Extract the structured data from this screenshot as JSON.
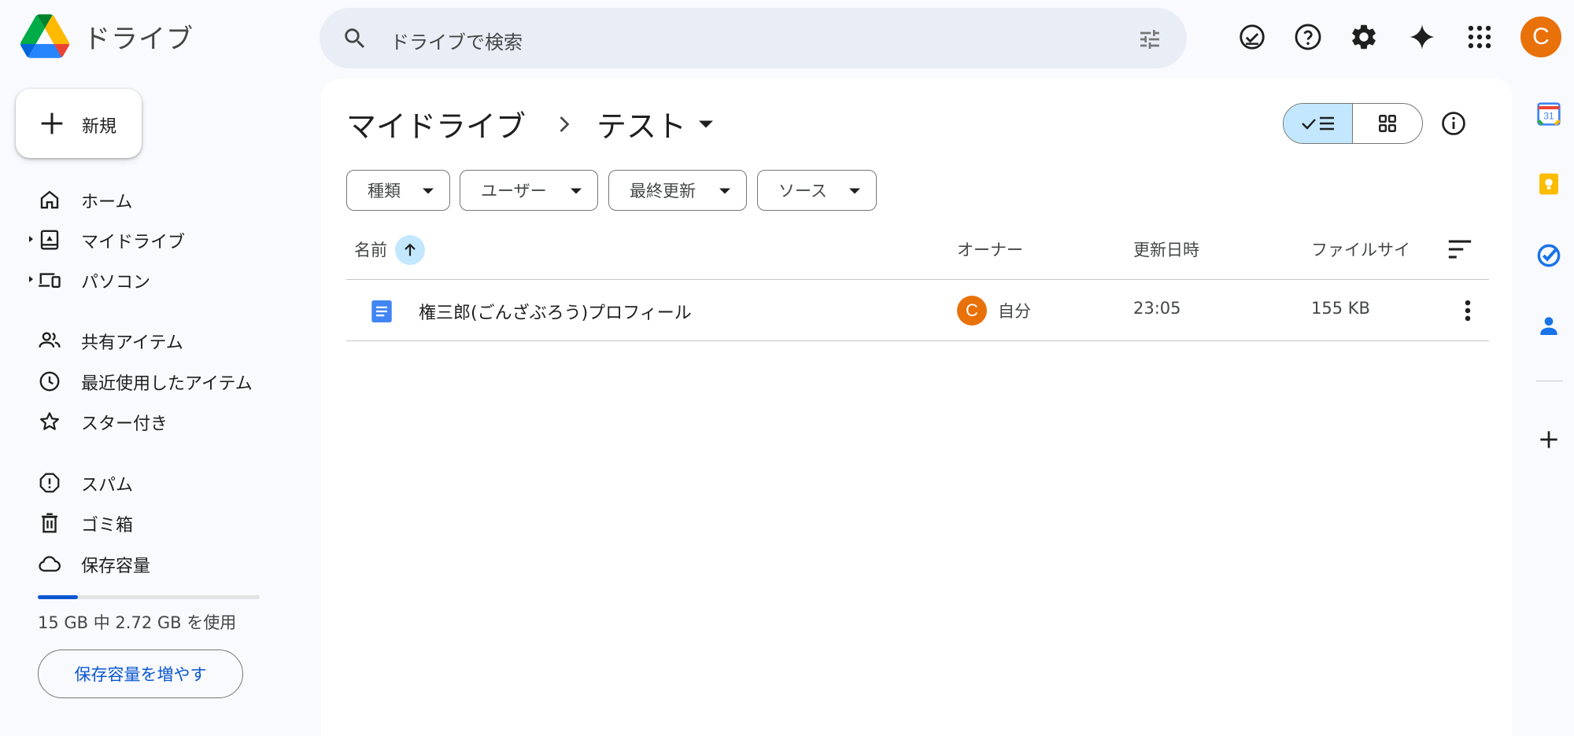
{
  "app": {
    "title": "ドライブ"
  },
  "search": {
    "placeholder": "ドライブで検索"
  },
  "header_icons": [
    "offline-ready-icon",
    "help-icon",
    "settings-icon",
    "gemini-icon",
    "apps-grid-icon"
  ],
  "account": {
    "initial": "C",
    "color": "#e8710a"
  },
  "new_button": {
    "label": "新規"
  },
  "nav": {
    "items": [
      {
        "label": "ホーム",
        "icon": "home-icon"
      },
      {
        "label": "マイドライブ",
        "icon": "my-drive-icon",
        "expandable": true
      },
      {
        "label": "パソコン",
        "icon": "computers-icon",
        "expandable": true
      },
      {
        "label": "共有アイテム",
        "icon": "shared-icon"
      },
      {
        "label": "最近使用したアイテム",
        "icon": "recent-icon"
      },
      {
        "label": "スター付き",
        "icon": "star-icon"
      },
      {
        "label": "スパム",
        "icon": "spam-icon"
      },
      {
        "label": "ゴミ箱",
        "icon": "trash-icon"
      },
      {
        "label": "保存容量",
        "icon": "cloud-icon"
      }
    ]
  },
  "storage": {
    "used_text": "15 GB 中 2.72 GB を使用",
    "used_fraction": 0.18,
    "button_label": "保存容量を増やす"
  },
  "breadcrumb": {
    "root": "マイドライブ",
    "current": "テスト"
  },
  "view": {
    "mode": "list"
  },
  "filters": [
    {
      "label": "種類"
    },
    {
      "label": "ユーザー"
    },
    {
      "label": "最終更新"
    },
    {
      "label": "ソース"
    }
  ],
  "table": {
    "columns": {
      "name": "名前",
      "owner": "オーナー",
      "modified": "更新日時",
      "size": "ファイルサイ"
    },
    "sort": "ascending",
    "rows": [
      {
        "name": "権三郎(ごんざぶろう)プロフィール",
        "owner_initial": "C",
        "owner": "自分",
        "modified": "23:05",
        "size": "155 KB",
        "type": "google-doc"
      }
    ]
  },
  "colors": {
    "accent": "#0b57d0",
    "selected": "#c2e7ff",
    "avatar": "#e8710a",
    "background": "#f8fafd"
  },
  "side_rail": [
    "calendar-icon",
    "keep-icon",
    "tasks-icon",
    "contacts-icon",
    "add-icon"
  ]
}
